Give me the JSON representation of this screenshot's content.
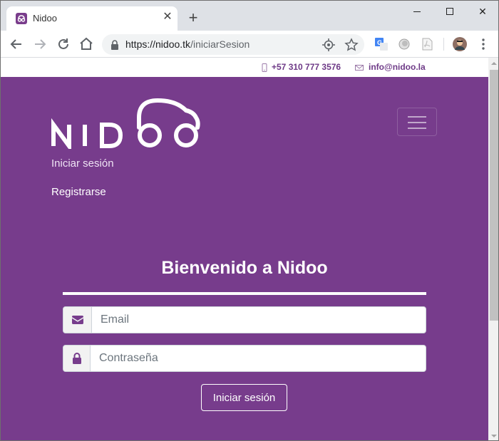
{
  "browser": {
    "tab_title": "Nidoo",
    "url_domain": "https://nidoo.tk",
    "url_path": "/iniciarSesion",
    "icons": [
      "back-icon",
      "forward-icon",
      "reload-icon",
      "home-icon",
      "lock-icon",
      "location-icon",
      "star-icon",
      "translate-icon",
      "extension-icon",
      "pdf-icon",
      "profile-avatar",
      "menu-icon"
    ]
  },
  "topbar": {
    "phone": "+57 310 777 3576",
    "email": "info@nidoo.la"
  },
  "brand": {
    "logo_text": "NIDOO",
    "color": "#773c8c",
    "accent": "#6e3a87"
  },
  "nav": {
    "login": "Iniciar sesión",
    "register": "Registrarse"
  },
  "login_form": {
    "heading": "Bienvenido a Nidoo",
    "email_placeholder": "Email",
    "password_placeholder": "Contraseña",
    "submit_label": "Iniciar sesión"
  }
}
